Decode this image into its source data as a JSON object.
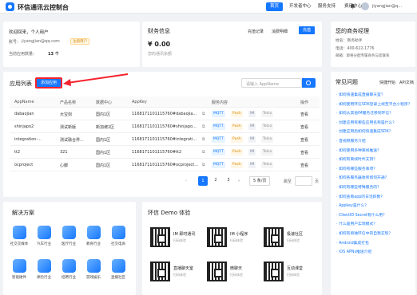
{
  "header": {
    "logo": "环信通讯云控制台",
    "nav": [
      "首页",
      "开发者中心",
      "服务支持",
      "费用中心"
    ],
    "user": "jiyangjian@q..."
  },
  "welcome": {
    "title": "欢迎回来，个人用户",
    "account_label": "账号：",
    "account": "jiyangjian@qq.com",
    "badge": "注册用户",
    "app_count_label": "当前应用数量：",
    "app_count": "13 个"
  },
  "finance": {
    "title": "财务信息",
    "recharge": "充值记录",
    "detail": "消费明细",
    "charge_btn": "充值",
    "amount": "¥ 0.00",
    "note": "您的通讯余额"
  },
  "manager": {
    "title": "您的商务经理",
    "name": "姓名：商务助手",
    "phone": "电话：400-622-1776",
    "desc": "邮箱：即将分配专属商务与您联系"
  },
  "applist": {
    "title": "应用列表",
    "add_btn": "添加应用",
    "search_placeholder": "请输入 AppName",
    "columns": [
      "AppName",
      "产品名称",
      "数据中心",
      "AppKey",
      "服务内容",
      "操作"
    ],
    "rows": [
      {
        "name": "dabaojian",
        "product": "大宝剑",
        "dc": "国内1区",
        "key": "1168171101115760#dabaojia..."
      },
      {
        "name": "shinjapo2",
        "product": "测试新版",
        "dc": "新加坡2区",
        "key": "1168171101115760#shinjapo..."
      },
      {
        "name": "integration-...",
        "product": "测试融合界...",
        "dc": "国内1区",
        "key": "1168171101115760#integrati..."
      },
      {
        "name": "tt2",
        "product": "321",
        "dc": "国内1区",
        "key": "1168171101115760#tt2"
      },
      {
        "name": "ocproject",
        "product": "心脚",
        "dc": "国内1区",
        "key": "1168171101115760#ocproject..."
      }
    ],
    "services": [
      "MQTT",
      "Push",
      "IM",
      "Telco"
    ],
    "action": "查看",
    "pages": [
      "1",
      "2",
      "3"
    ],
    "page_size": "5 条/页",
    "jump": "跳至",
    "page_unit": "页"
  },
  "faq": {
    "title": "常见问题",
    "links": [
      "快捷开始",
      "API文档"
    ],
    "items": [
      "如何快速集成直播聊天室？",
      "如何使用环信SDK登录上线至平台小程序？",
      "如何从其他IM服务迁移到环信？",
      "创建应用有哪些应用名称是什么？",
      "创建应用后如何快速集成SDK？",
      "音视频服务介绍",
      "如何使用多种离线推送？",
      "如何有离线时件支持？",
      "如何有哪些服务事项？",
      "如何各服务器收到如何开通？",
      "如何有哪些特殊服务的？",
      "如何查看app的日活跃数？",
      "Appkey是什么？",
      "ClientID Secret有什么用？",
      "什么是用户实现模式？",
      "如何有单独环信中的自我实现？",
      "Android集成打包",
      "iOS APNs推送介绍"
    ]
  },
  "solutions": {
    "title": "解决方案",
    "items": [
      "社交交媒体",
      "汽车行业",
      "医疗行业",
      "教育行业",
      "社交电商",
      "智能硬件",
      "保险行业",
      "招聘行业",
      "游戏娱乐",
      "直播社区"
    ]
  },
  "demo": {
    "title": "环信 Demo 体验",
    "items": [
      {
        "name": "IM 即时通讯",
        "sub": "扫码体验"
      },
      {
        "name": "IM 小程序",
        "sub": "扫码体验"
      },
      {
        "name": "极速社区",
        "sub": "扫码体验"
      },
      {
        "name": "直播聊天室",
        "sub": "扫码体验"
      },
      {
        "name": "微聊天",
        "sub": "扫码体验"
      },
      {
        "name": "互动课堂",
        "sub": "扫码体验"
      }
    ]
  },
  "colors": {
    "accent": "#1677ff",
    "annotation": "#f5222d"
  }
}
